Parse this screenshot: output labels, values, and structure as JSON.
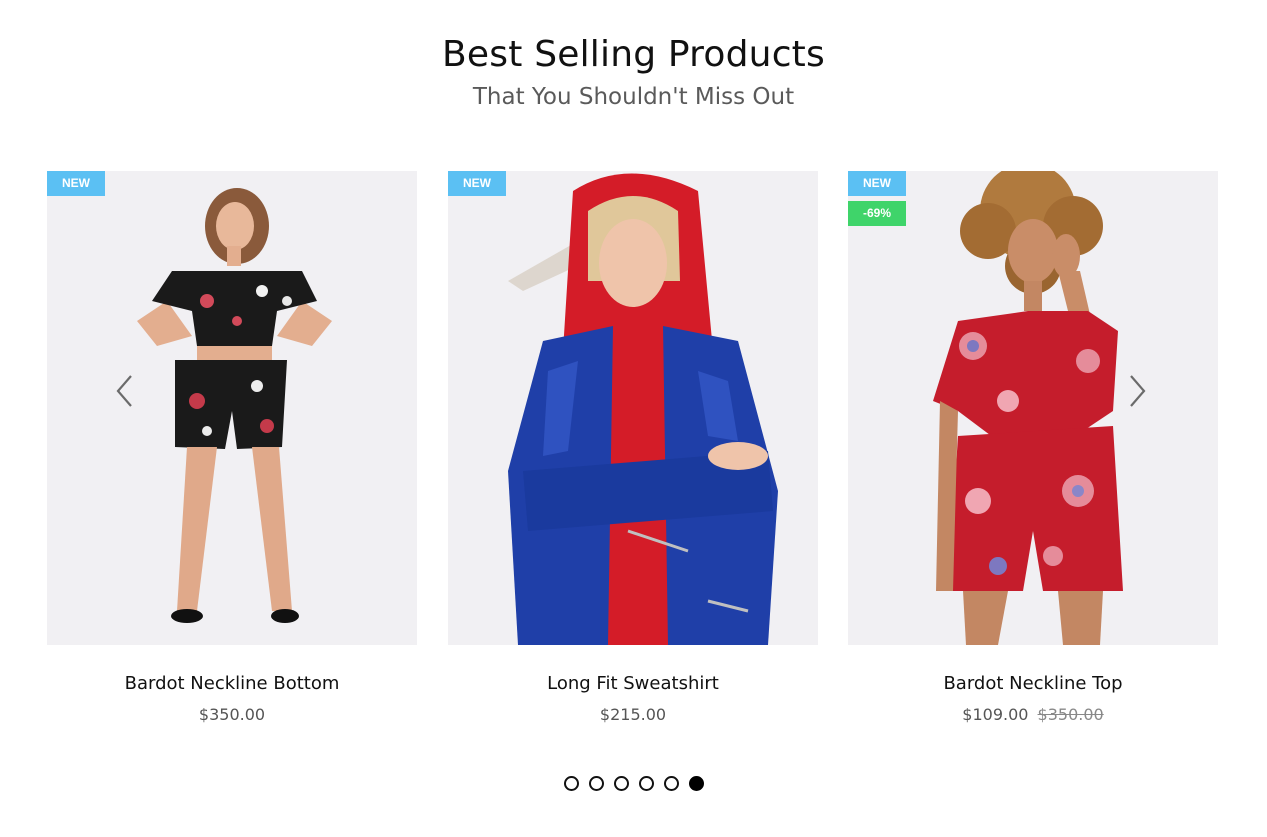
{
  "section": {
    "title": "Best Selling Products",
    "subtitle": "That You Shouldn't Miss Out"
  },
  "products": [
    {
      "name": "Bardot Neckline Bottom",
      "price": "$350.00",
      "old_price": "",
      "badge_new": "NEW",
      "badge_sale": ""
    },
    {
      "name": "Long Fit Sweatshirt",
      "price": "$215.00",
      "old_price": "",
      "badge_new": "NEW",
      "badge_sale": ""
    },
    {
      "name": "Bardot Neckline Top",
      "price": "$109.00",
      "old_price": "$350.00",
      "badge_new": "NEW",
      "badge_sale": "-69%"
    }
  ],
  "carousel": {
    "prev_icon": "chevron-left-icon",
    "next_icon": "chevron-right-icon",
    "page_count": 6,
    "active_page": 6
  },
  "colors": {
    "badge_new": "#5bc0f3",
    "badge_sale": "#3fd46a",
    "image_bg": "#f1f0f3"
  }
}
